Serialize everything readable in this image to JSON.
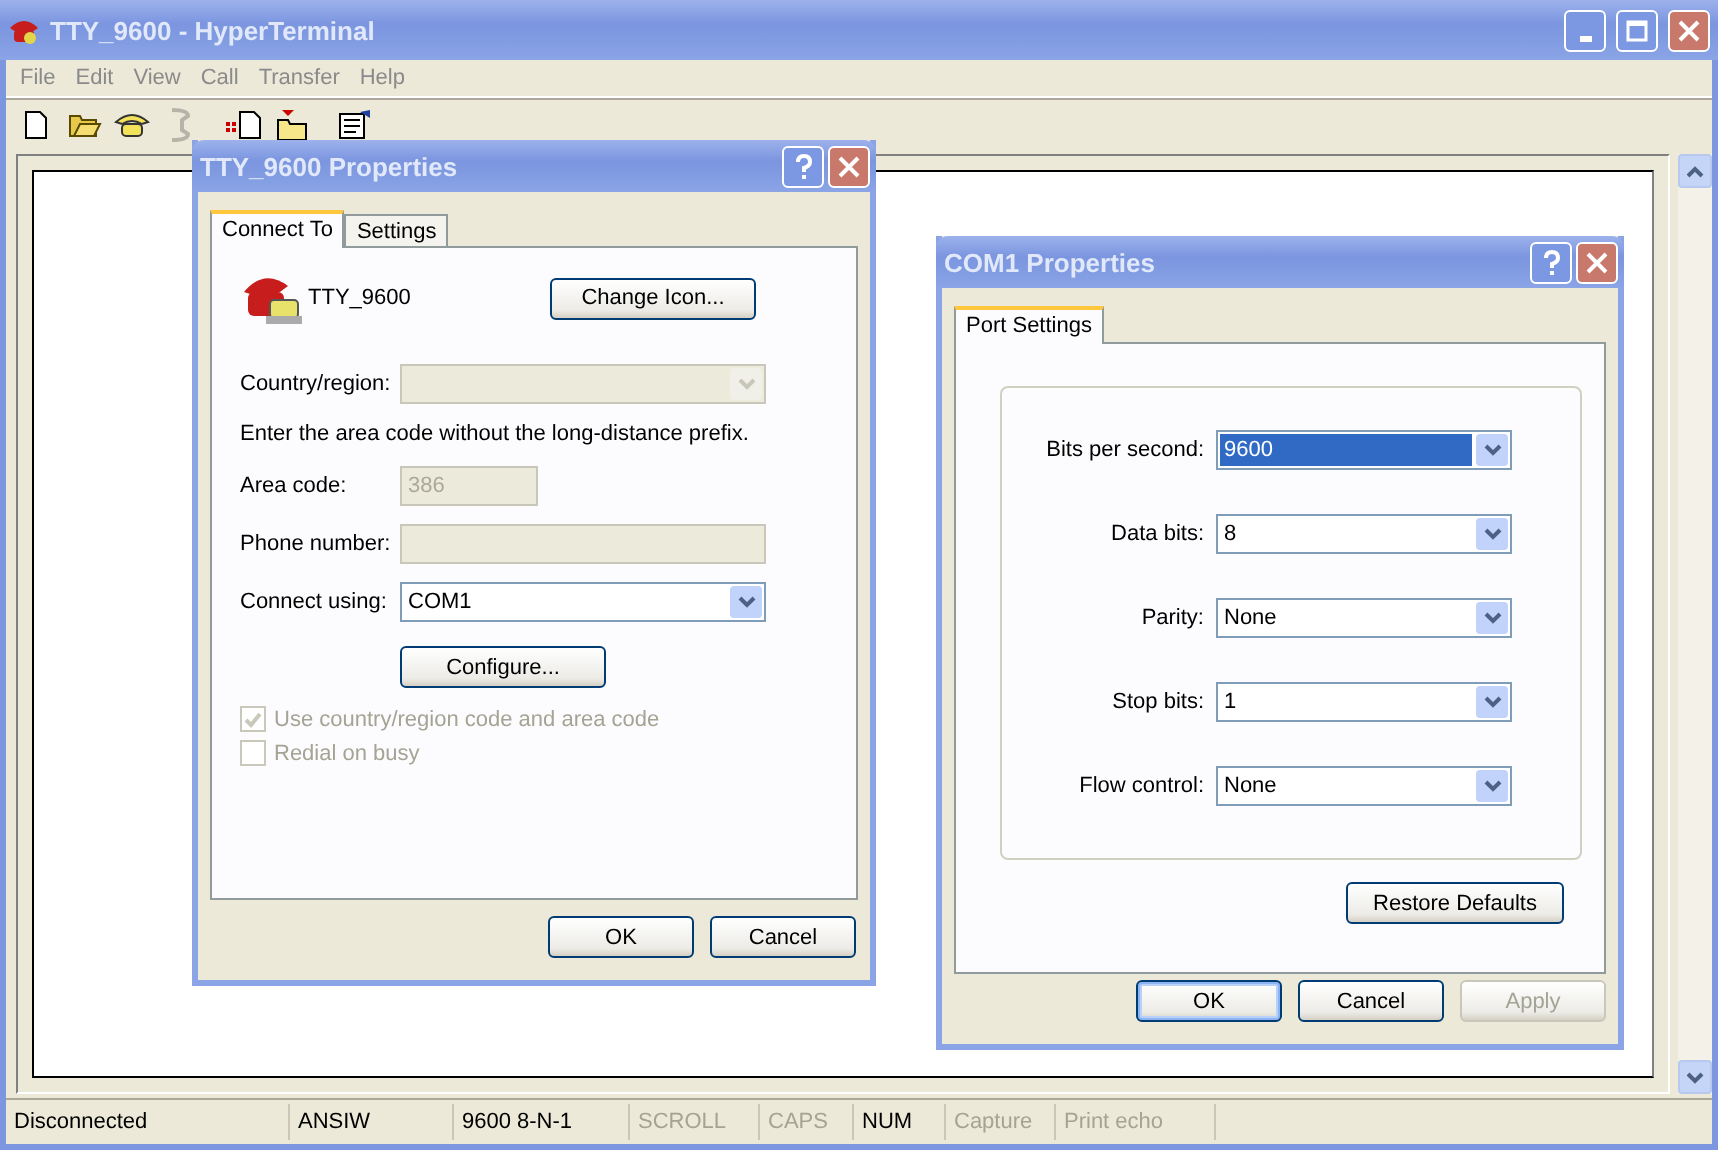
{
  "window": {
    "title": "TTY_9600 - HyperTerminal",
    "active": false
  },
  "menu": [
    "File",
    "Edit",
    "View",
    "Call",
    "Transfer",
    "Help"
  ],
  "toolbar": [
    {
      "kind": "new",
      "disabled": false
    },
    {
      "kind": "open",
      "disabled": false
    },
    {
      "kind": "dial",
      "disabled": false
    },
    {
      "kind": "hangup",
      "disabled": true
    },
    {
      "kind": "send",
      "disabled": false
    },
    {
      "kind": "receive",
      "disabled": false
    },
    {
      "kind": "properties",
      "disabled": false
    }
  ],
  "status_bar": [
    {
      "text": "Disconnected",
      "disabled": false
    },
    {
      "text": "ANSIW",
      "disabled": false
    },
    {
      "text": "9600 8-N-1",
      "disabled": false
    },
    {
      "text": "SCROLL",
      "disabled": true
    },
    {
      "text": "CAPS",
      "disabled": true
    },
    {
      "text": "NUM",
      "disabled": false
    },
    {
      "text": "Capture",
      "disabled": true
    },
    {
      "text": "Print echo",
      "disabled": true
    }
  ],
  "properties_dialog": {
    "title": "TTY_9600 Properties",
    "active": false,
    "tabs": [
      {
        "label": "Connect To",
        "selected": true
      },
      {
        "label": "Settings",
        "selected": false
      }
    ],
    "connection_name": "TTY_9600",
    "change_icon_button": "Change Icon...",
    "country_region": {
      "label": "Country/region:",
      "disabled": true
    },
    "hint": "Enter the area code without the long-distance prefix.",
    "area_code": {
      "label": "Area code:",
      "value": "386",
      "disabled": true
    },
    "phone_number": {
      "label": "Phone number:",
      "disabled": true
    },
    "connect_using": {
      "label": "Connect using:",
      "value": "COM1"
    },
    "configure_button": "Configure...",
    "checkboxes": [
      {
        "label": "Use country/region code and area code",
        "checked": true,
        "disabled": true
      },
      {
        "label": "Redial on busy",
        "checked": false,
        "disabled": true
      }
    ],
    "buttons": [
      {
        "label": "OK",
        "default": false,
        "disabled": false
      },
      {
        "label": "Cancel",
        "default": false,
        "disabled": false
      }
    ]
  },
  "com_dialog": {
    "title": "COM1 Properties",
    "active": false,
    "tabs": [
      {
        "label": "Port Settings",
        "selected": true
      }
    ],
    "fields": [
      {
        "label": "Bits per second:",
        "value": "9600",
        "selected": true
      },
      {
        "label": "Data bits:",
        "value": "8",
        "selected": false
      },
      {
        "label": "Parity:",
        "value": "None",
        "selected": false
      },
      {
        "label": "Stop bits:",
        "value": "1",
        "selected": false
      },
      {
        "label": "Flow control:",
        "value": "None",
        "selected": false
      }
    ],
    "restore_button": "Restore Defaults",
    "buttons": [
      {
        "label": "OK",
        "default": true,
        "disabled": false
      },
      {
        "label": "Cancel",
        "default": false,
        "disabled": false
      },
      {
        "label": "Apply",
        "default": false,
        "disabled": true
      }
    ]
  }
}
